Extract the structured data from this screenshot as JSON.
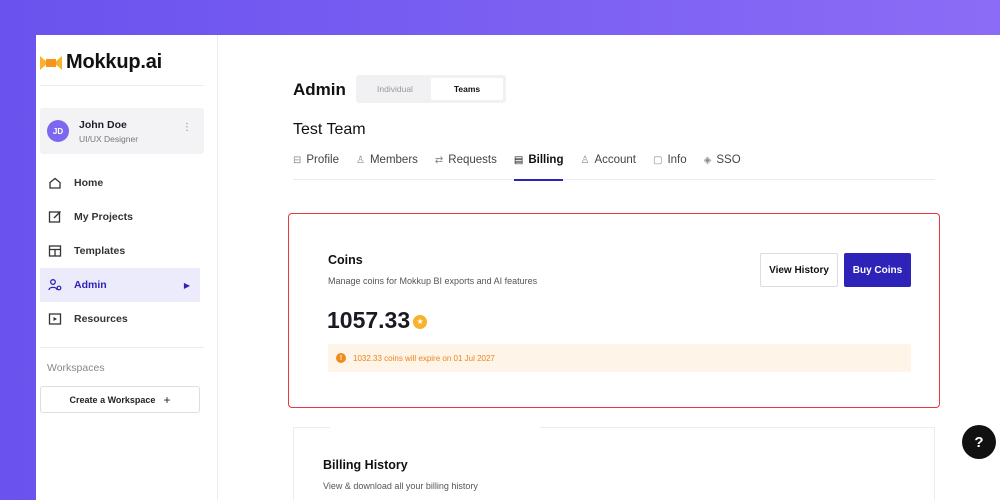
{
  "sidebar": {
    "logo_text": "Mokkup.ai",
    "user": {
      "initials": "JD",
      "name": "John Doe",
      "role": "UI/UX Designer",
      "menu_glyph": "⋮"
    },
    "nav": [
      {
        "label": "Home",
        "icon": "home-icon"
      },
      {
        "label": "My Projects",
        "icon": "edit-icon"
      },
      {
        "label": "Templates",
        "icon": "templates-icon"
      },
      {
        "label": "Admin",
        "icon": "admin-icon",
        "active": true
      },
      {
        "label": "Resources",
        "icon": "play-box-icon"
      }
    ],
    "workspaces_label": "Workspaces",
    "create_workspace_label": "Create a Workspace",
    "create_workspace_plus": "+"
  },
  "main": {
    "title": "Admin",
    "segment": {
      "options": [
        "Individual",
        "Teams"
      ],
      "selected": "Teams"
    },
    "team_name": "Test Team",
    "tabs": [
      {
        "label": "Profile",
        "icon": "⊟"
      },
      {
        "label": "Members",
        "icon": "♙"
      },
      {
        "label": "Requests",
        "icon": "⇄"
      },
      {
        "label": "Billing",
        "icon": "▤",
        "active": true
      },
      {
        "label": "Account",
        "icon": "♙"
      },
      {
        "label": "Info",
        "icon": "▢"
      },
      {
        "label": "SSO",
        "icon": "◈"
      }
    ],
    "coins": {
      "title": "Coins",
      "subtitle": "Manage coins for Mokkup BI exports and AI features",
      "view_history_label": "View History",
      "buy_coins_label": "Buy Coins",
      "amount": "1057.33",
      "expire_notice": "1032.33 coins will expire on 01 Jul 2027"
    },
    "billing": {
      "title": "Billing History",
      "subtitle": "View & download all your billing history"
    }
  },
  "help_label": "?",
  "colors": {
    "accent": "#2e23b9",
    "highlight_border": "#e8383d",
    "warning": "#f08c1e",
    "coin": "#f7b32b",
    "background_gradient_start": "#6a52ee",
    "background_gradient_end": "#8b6cf6"
  }
}
